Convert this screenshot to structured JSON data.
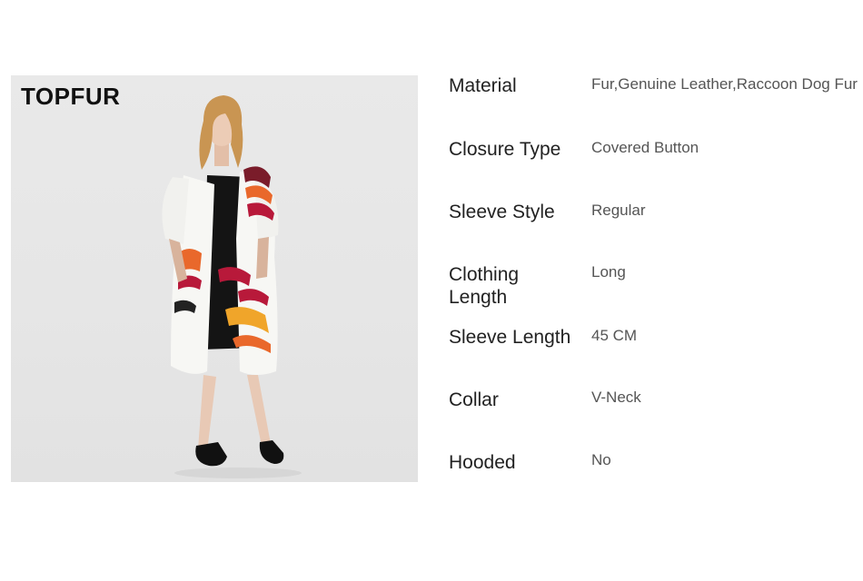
{
  "brand": {
    "logo_text": "TOPFUR"
  },
  "product_image": {
    "alt": "model-wearing-multicolor-fur-coat"
  },
  "colors": {
    "background": "#ffffff",
    "photo_background": "#e7e7e7",
    "label_text": "#222222",
    "value_text": "#555555",
    "fur_white": "#f7f7f4",
    "fur_red": "#b8193a",
    "fur_orange": "#e9682b",
    "fur_yellow": "#f0a52a",
    "dress_black": "#141414"
  },
  "specs": [
    {
      "label": "Material",
      "value": "Fur,Genuine Leather,Raccoon Dog Fur"
    },
    {
      "label": "Closure Type",
      "value": "Covered Button"
    },
    {
      "label": "Sleeve Style",
      "value": "Regular"
    },
    {
      "label": "Clothing Length",
      "value": "Long"
    },
    {
      "label": "Sleeve Length",
      "value": "45 CM"
    },
    {
      "label": "Collar",
      "value": "V-Neck"
    },
    {
      "label": "Hooded",
      "value": "No"
    }
  ]
}
